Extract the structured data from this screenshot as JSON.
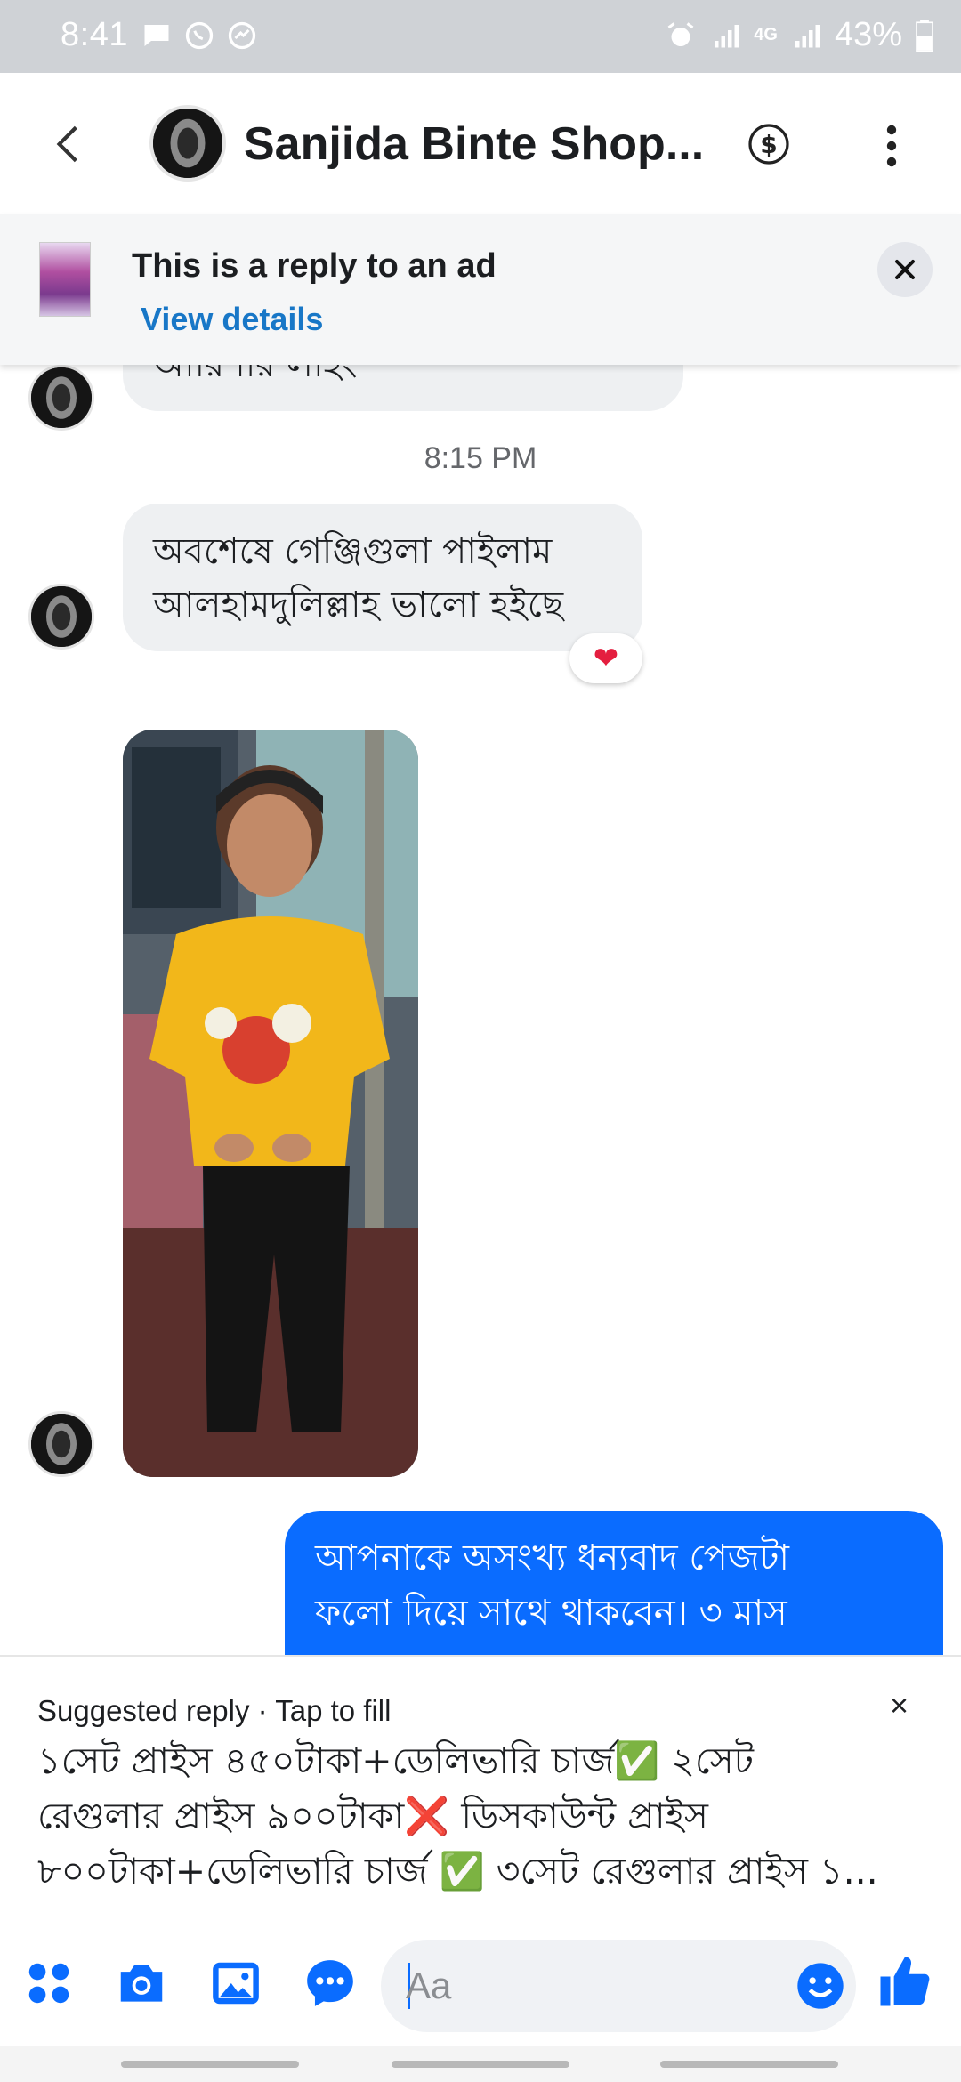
{
  "status_bar": {
    "time": "8:41",
    "battery": "43%",
    "network": "4G",
    "icons": [
      "message-icon",
      "whatsapp-icon",
      "messenger-icon",
      "alarm-icon",
      "signal-icon",
      "signal-icon",
      "battery-icon"
    ]
  },
  "header": {
    "title": "Sanjida Binte Shop...",
    "icons": [
      "back-icon",
      "dollar-icon",
      "more-icon"
    ]
  },
  "ad_banner": {
    "title": "This is a reply to an ad",
    "link": "View details",
    "close_icon": "close-icon"
  },
  "chat": {
    "clipped_text": "আরিশার লাইং",
    "timestamp": "8:15 PM",
    "incoming_message": {
      "line1": "অবশেষে  গেঞ্জিগুলা পাইলাম",
      "line2": "আলহামদুলিল্লাহ ভালো হইছে",
      "reaction": "❤"
    },
    "photo_label": "child-in-yellow-shirt-photo",
    "outgoing_message": {
      "line1": "আপনাকে অসংখ্য ধন্যবাদ পেজটা",
      "line2": "ফলো দিয়ে সাথে থাকবেন। ৩ মাস"
    }
  },
  "suggested_reply": {
    "header": "Suggested reply · Tap to fill",
    "close": "×",
    "line1": "১সেট প্রাইস ৪৫০টাকা+ডেলিভারি চার্জ✅ ২সেট",
    "line2": "রেগুলার প্রাইস ৯০০টাকা❌ ডিসকাউন্ট প্রাইস",
    "line3": "৮০০টাকা+ডেলিভারি চার্জ ✅ ৩সেট রেগুলার প্রাইস ১..."
  },
  "composer": {
    "placeholder": "Aa",
    "icons": [
      "apps-icon",
      "camera-icon",
      "gallery-icon",
      "chat-bubble-icon",
      "emoji-icon",
      "like-icon"
    ]
  },
  "colors": {
    "accent": "#0a6cff",
    "link": "#1877c7",
    "bubble_in": "#eef0f2",
    "status_bar": "#cfd2d6"
  }
}
